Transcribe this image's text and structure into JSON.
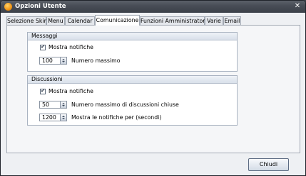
{
  "window": {
    "title": "Opzioni Utente",
    "close_glyph": "✕"
  },
  "tabs": [
    {
      "label": "Selezione Skin",
      "active": false
    },
    {
      "label": "Menu",
      "active": false
    },
    {
      "label": "Calendar",
      "active": false
    },
    {
      "label": "Comunicazione",
      "active": true
    },
    {
      "label": "Funzioni Amministratore",
      "active": false
    },
    {
      "label": "Varie",
      "active": false
    },
    {
      "label": "Email",
      "active": false
    }
  ],
  "messaggi": {
    "header": "Messaggi",
    "show_notifications": {
      "label": "Mostra notifiche",
      "checked": true,
      "check_glyph": "✔"
    },
    "max_number": {
      "value": "100",
      "label": "Numero massimo"
    }
  },
  "discussioni": {
    "header": "Discussioni",
    "show_notifications": {
      "label": "Mostra notifiche",
      "checked": true,
      "check_glyph": "✔"
    },
    "max_closed": {
      "value": "50",
      "label": "Numero massimo di discussioni chiuse"
    },
    "show_for": {
      "value": "1200",
      "label": "Mostra le notifiche per (secondi)"
    }
  },
  "footer": {
    "close_label": "Chiudi"
  }
}
